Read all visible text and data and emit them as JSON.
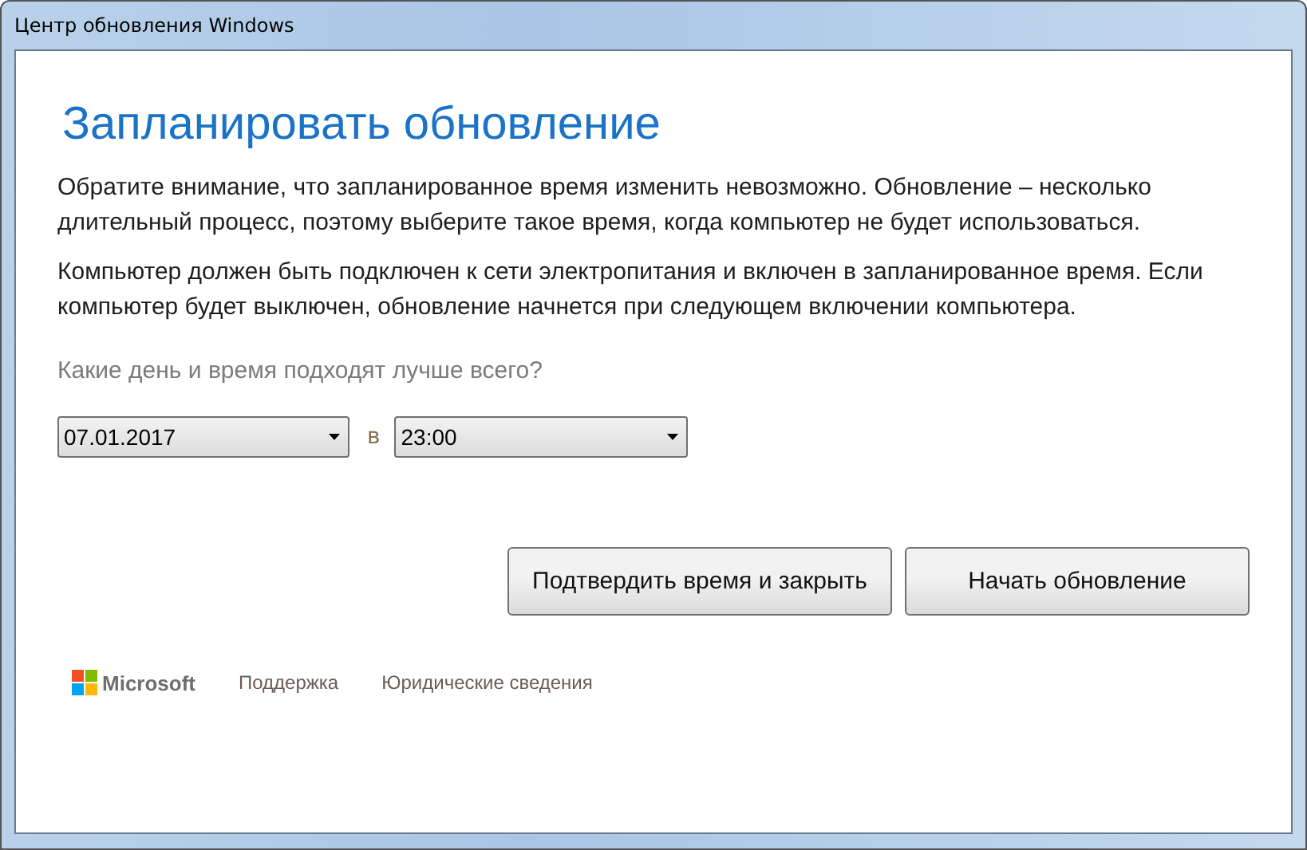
{
  "window": {
    "title": "Центр обновления Windows"
  },
  "heading": "Запланировать обновление",
  "paragraphs": [
    "Обратите внимание, что запланированное время изменить невозможно. Обновление – несколько длительный процесс, поэтому выберите такое время, когда компьютер не будет использоваться.",
    "Компьютер должен быть подключен к сети электропитания и включен в запланированное время. Если компьютер будет выключен, обновление начнется при следующем включении компьютера."
  ],
  "question": "Какие день и время подходят лучше всего?",
  "date_select": {
    "value": "07.01.2017"
  },
  "separator": "в",
  "time_select": {
    "value": "23:00"
  },
  "buttons": [
    "Подтвердить время и закрыть",
    "Начать обновление"
  ],
  "footer": {
    "brand": "Microsoft",
    "links": [
      "Поддержка",
      "Юридические сведения"
    ]
  }
}
